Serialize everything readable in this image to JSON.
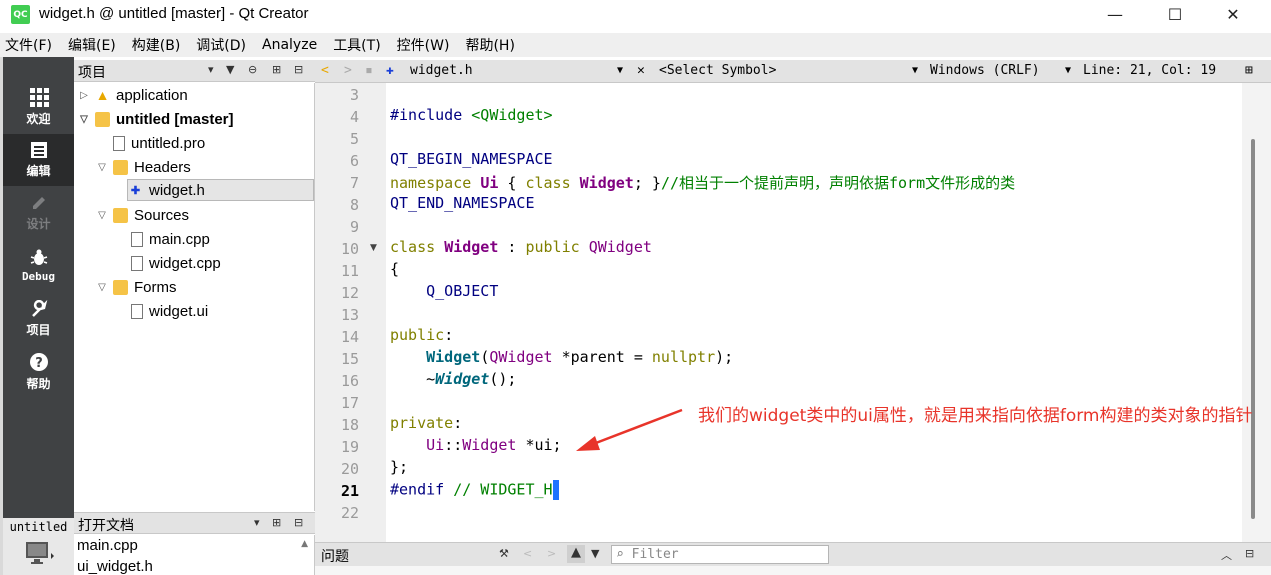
{
  "window": {
    "logo_text": "QC",
    "title": "widget.h @ untitled [master] - Qt Creator",
    "minimize": "—",
    "maximize": "☐",
    "close": "✕"
  },
  "menu": [
    "文件(F)",
    "编辑(E)",
    "构建(B)",
    "调试(D)",
    "Analyze",
    "工具(T)",
    "控件(W)",
    "帮助(H)"
  ],
  "modes": [
    {
      "label": "欢迎",
      "icon": "grid-icon"
    },
    {
      "label": "编辑",
      "icon": "document-icon"
    },
    {
      "label": "设计",
      "icon": "pencil-icon"
    },
    {
      "label": "Debug",
      "icon": "bug-icon"
    },
    {
      "label": "项目",
      "icon": "wrench-icon"
    },
    {
      "label": "帮助",
      "icon": "help-icon"
    }
  ],
  "kit": {
    "label": "untitled"
  },
  "project_panel": {
    "title": "项目",
    "tree": [
      {
        "label": "application"
      },
      {
        "label": "untitled [master]"
      },
      {
        "label": "untitled.pro"
      },
      {
        "label": "Headers"
      },
      {
        "label": "widget.h"
      },
      {
        "label": "Sources"
      },
      {
        "label": "main.cpp"
      },
      {
        "label": "widget.cpp"
      },
      {
        "label": "Forms"
      },
      {
        "label": "widget.ui"
      }
    ]
  },
  "open_docs": {
    "title": "打开文档",
    "items": [
      "main.cpp",
      "ui_widget.h"
    ]
  },
  "editor_toolbar": {
    "file": "widget.h",
    "symbol": "<Select Symbol>",
    "line_ending": "Windows (CRLF)",
    "position": "Line: 21, Col: 19"
  },
  "editor": {
    "line_numbers": [
      "3",
      "4",
      "5",
      "6",
      "7",
      "8",
      "9",
      "10",
      "11",
      "12",
      "13",
      "14",
      "15",
      "16",
      "17",
      "18",
      "19",
      "20",
      "21",
      "22"
    ],
    "current_line": "21"
  },
  "annotation": {
    "text": "我们的widget类中的ui属性，就是用来指向依据form构建的类对象的指针"
  },
  "issues": {
    "label": "问题",
    "filter_placeholder": "Filter"
  },
  "colors": {
    "accent": "#1e73ff",
    "annotation": "#e8342a",
    "keyword": "#808000",
    "type": "#800080",
    "comment": "#008000"
  }
}
